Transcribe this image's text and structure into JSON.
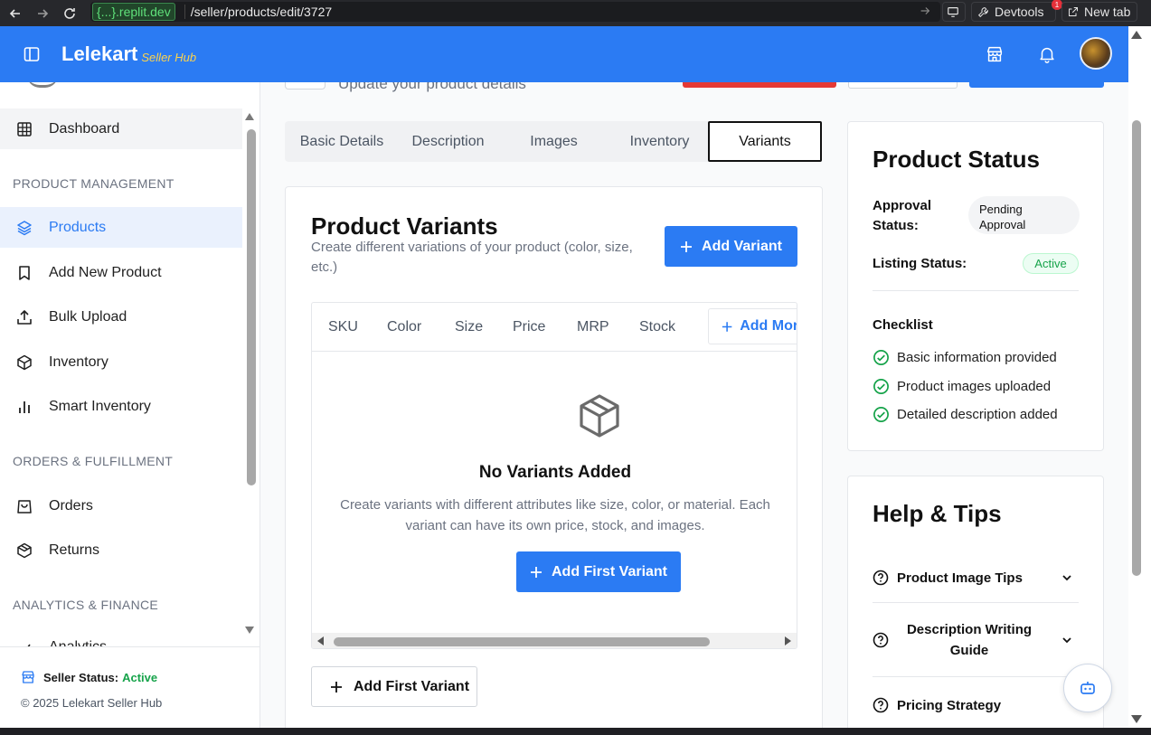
{
  "browser": {
    "url_host": "{...}.replit.dev",
    "url_path": "/seller/products/edit/3727",
    "devtools_label": "Devtools",
    "devtools_badge": "1",
    "new_tab_label": "New tab"
  },
  "header": {
    "brand": "Lelekart",
    "brand_sub": "Seller Hub"
  },
  "sidebar": {
    "items": [
      {
        "label": "Dashboard",
        "icon": "grid-icon"
      },
      {
        "label": "Products",
        "icon": "layers-icon"
      },
      {
        "label": "Add New Product",
        "icon": "bookmark-icon"
      },
      {
        "label": "Bulk Upload",
        "icon": "upload-icon"
      },
      {
        "label": "Inventory",
        "icon": "box-icon"
      },
      {
        "label": "Smart Inventory",
        "icon": "bar-chart-icon"
      },
      {
        "label": "Orders",
        "icon": "shopping-bag-icon"
      },
      {
        "label": "Returns",
        "icon": "package-return-icon"
      },
      {
        "label": "Analytics",
        "icon": "analytics-icon"
      }
    ],
    "sections": {
      "product": "PRODUCT MANAGEMENT",
      "orders": "ORDERS & FULFILLMENT",
      "analytics": "ANALYTICS & FINANCE"
    },
    "footer": {
      "status_label": "Seller Status:",
      "status_value": "Active",
      "copyright": "© 2025 Lelekart Seller Hub"
    }
  },
  "page": {
    "subtitle": "Update your product details"
  },
  "tabs": [
    "Basic Details",
    "Description",
    "Images",
    "Inventory",
    "Variants"
  ],
  "variants": {
    "title": "Product Variants",
    "description": "Create different variations of your product (color, size, etc.)",
    "add_button": "Add Variant",
    "columns": [
      "SKU",
      "Color",
      "Size",
      "Price",
      "MRP",
      "Stock"
    ],
    "add_more": "Add More",
    "empty_title": "No Variants Added",
    "empty_text": "Create variants with different attributes like size, color, or material. Each variant can have its own price, stock, and images.",
    "add_first": "Add First Variant",
    "add_first_outline": "Add First Variant"
  },
  "status_card": {
    "title": "Product Status",
    "approval_label": "Approval Status:",
    "approval_value": "Pending Approval",
    "listing_label": "Listing Status:",
    "listing_value": "Active",
    "checklist_title": "Checklist",
    "checklist": [
      "Basic information provided",
      "Product images uploaded",
      "Detailed description added"
    ]
  },
  "help_card": {
    "title": "Help & Tips",
    "items": [
      "Product Image Tips",
      "Description Writing Guide",
      "Pricing Strategy"
    ]
  },
  "colors": {
    "primary": "#2b7bf3",
    "success": "#16a34a",
    "brand_sub": "#fcd34d"
  }
}
